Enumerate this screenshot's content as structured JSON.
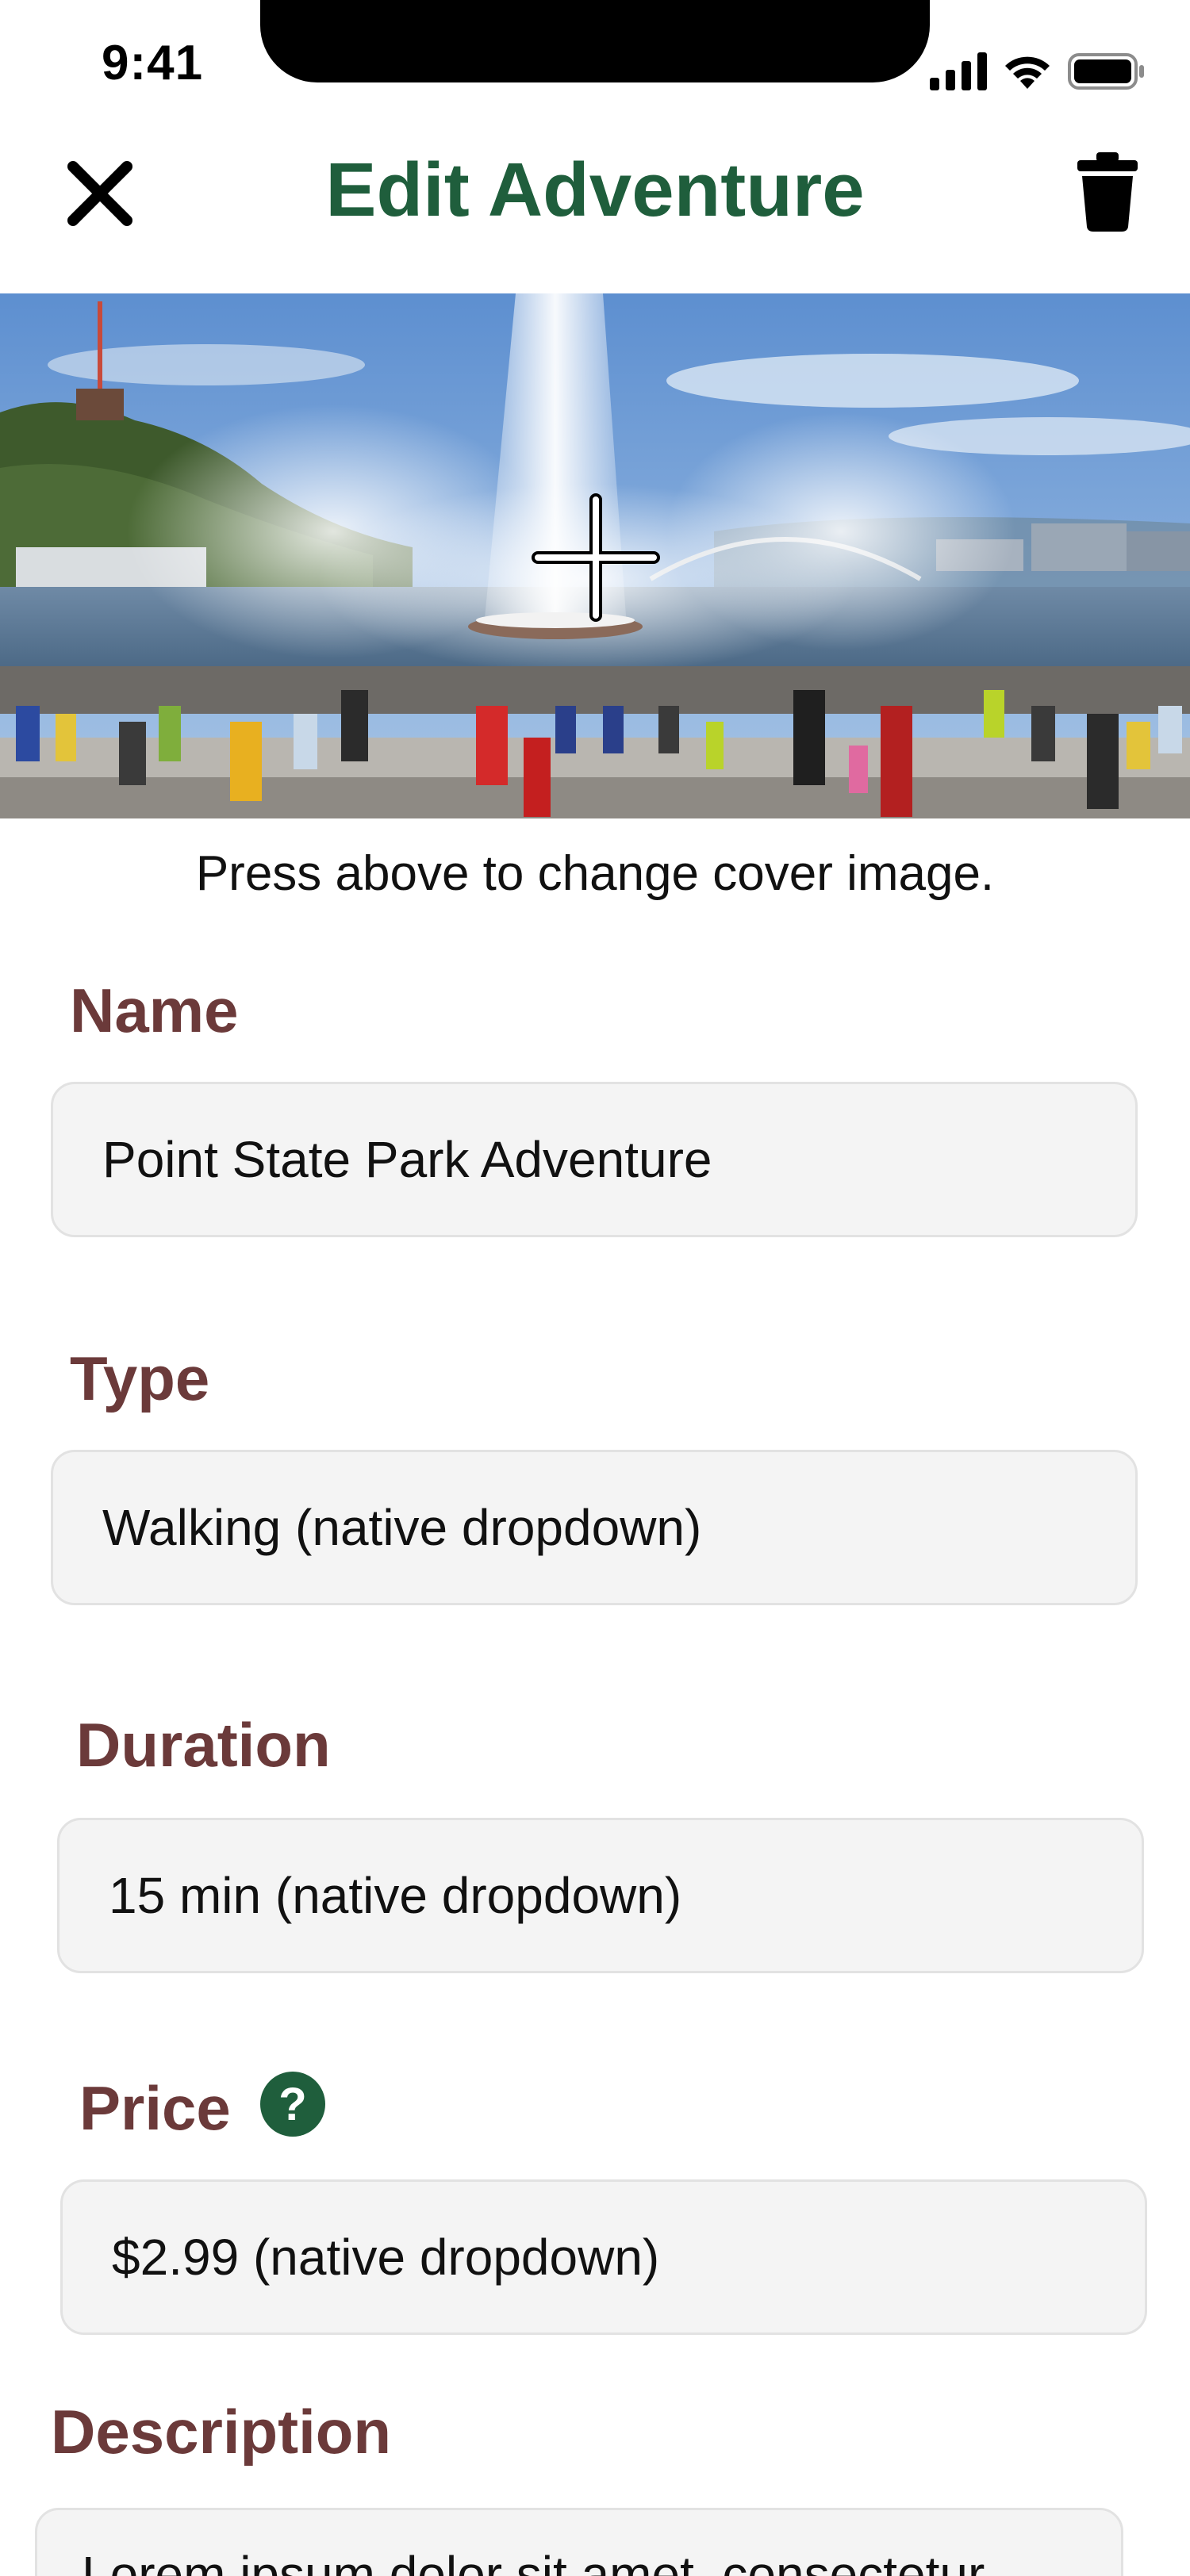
{
  "status_bar": {
    "time": "9:41"
  },
  "header": {
    "title": "Edit Adventure",
    "close_icon": "close-icon",
    "delete_icon": "trash-icon"
  },
  "cover": {
    "hint": "Press above to change cover image.",
    "add_icon": "plus-icon"
  },
  "form": {
    "name": {
      "label": "Name",
      "value": "Point State Park Adventure"
    },
    "type": {
      "label": "Type",
      "value": "Walking (native dropdown)"
    },
    "duration": {
      "label": "Duration",
      "value": "15 min (native dropdown)"
    },
    "price": {
      "label": "Price",
      "help_glyph": "?",
      "value": "$2.99 (native dropdown)"
    },
    "description": {
      "label": "Description",
      "value": "Lorem ipsum dolor sit amet, consectetur"
    }
  },
  "colors": {
    "title": "#1f5e3c",
    "label": "#6b3a3a",
    "field_bg": "#f4f4f4",
    "help_badge": "#1f5e3c"
  }
}
